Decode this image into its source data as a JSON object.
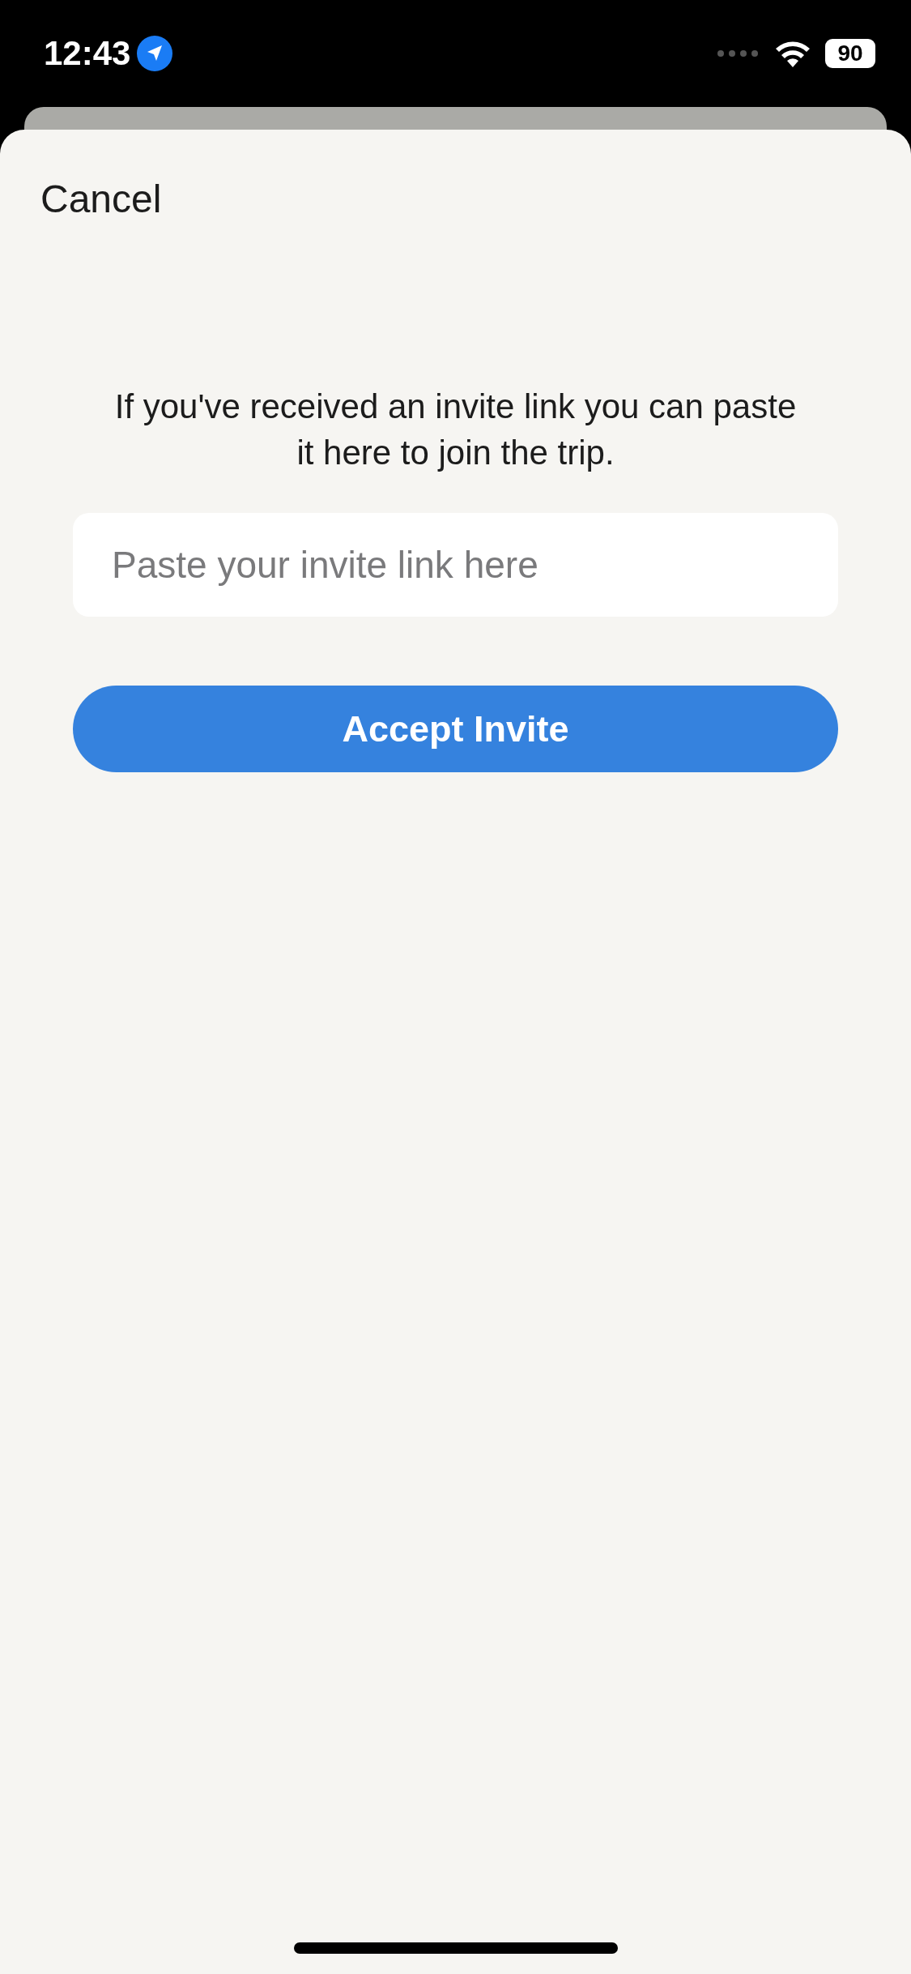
{
  "status_bar": {
    "time": "12:43",
    "battery": "90"
  },
  "sheet": {
    "cancel": "Cancel",
    "message": "If you've received an invite link you can paste it here to join the trip.",
    "invite_field": {
      "placeholder": "Paste your invite link here"
    },
    "accept_button": "Accept Invite"
  }
}
